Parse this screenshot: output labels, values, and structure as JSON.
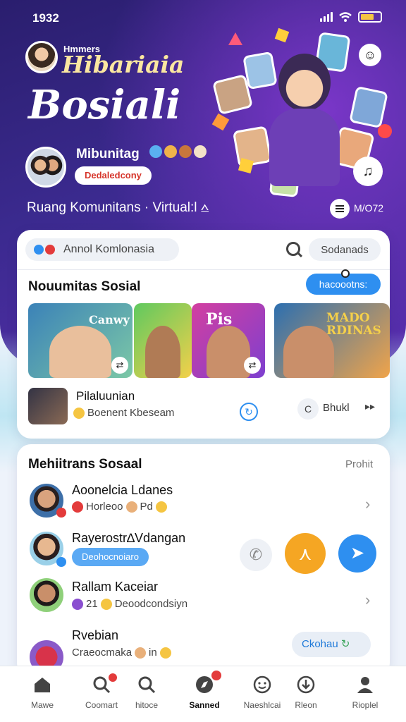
{
  "status": {
    "time": "1932"
  },
  "header": {
    "brand_small": "Hmmers",
    "brand_title": "Hibariaia",
    "brand_big": "Bosiali",
    "profile_name": "Mibunitag",
    "profile_tag": "Dedaledcony",
    "subtitle": "Ruang Komunitans · Virtual:l ⩟",
    "counter": "M/O72"
  },
  "search": {
    "brand_label": "Annol Komlonasia",
    "field_value": "Sodanads"
  },
  "communities": {
    "title": "Nouumitas Sosial",
    "action_label": "hacoootns:",
    "tiles": [
      {
        "word": "Canwy"
      },
      {
        "word": "Pis"
      },
      {
        "word": "MADO RDINAS"
      }
    ],
    "group": {
      "title": "Pilaluunian",
      "meta": "Boenent Kbeseam"
    },
    "side_label": "Bhukl"
  },
  "recommendations": {
    "title": "Mehiitrans Sosaal",
    "link": "Prohit",
    "items": [
      {
        "name": "Aoonelcia Ldanes",
        "meta": "Horleoo",
        "meta2": "Pd"
      },
      {
        "name": "Rayerostr∆Vdangan",
        "tag": "Deohocnoiaro"
      },
      {
        "name": "Rallam Kaceiar",
        "meta": "21",
        "meta2": "Deoodcondsiyn"
      },
      {
        "name": "Rvebian",
        "meta": "Craeocmaka",
        "meta2": "in"
      }
    ],
    "connect_label": "Ckohau"
  },
  "tabs": [
    {
      "label": "Mawe"
    },
    {
      "label": "Coomart"
    },
    {
      "label": "hitoce"
    },
    {
      "label": "Sanned"
    },
    {
      "label": "Naeshlcai"
    },
    {
      "label": "Rleon"
    },
    {
      "label": "Rioplel"
    }
  ],
  "colors": {
    "accent": "#2e8ff0",
    "orange": "#f5a623",
    "hero": "#3b2a8f"
  }
}
